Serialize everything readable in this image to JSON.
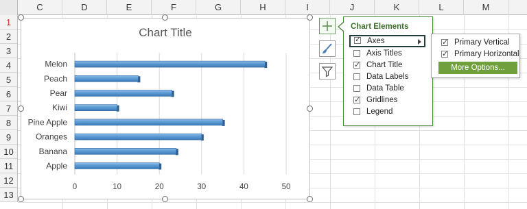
{
  "sheet": {
    "columns": [
      "C",
      "D",
      "E",
      "F",
      "G",
      "H",
      "I",
      "J",
      "K",
      "L",
      "M"
    ],
    "rows": [
      "1",
      "2",
      "3",
      "4",
      "5",
      "6",
      "7",
      "8",
      "9",
      "10",
      "11",
      "12",
      "13"
    ]
  },
  "chart": {
    "title": "Chart Title"
  },
  "chart_data": {
    "type": "bar",
    "orientation": "horizontal",
    "title": "Chart Title",
    "categories": [
      "Melon",
      "Peach",
      "Pear",
      "Kiwi",
      "Pine Apple",
      "Oranges",
      "Banana",
      "Apple"
    ],
    "values": [
      45,
      15,
      23,
      10,
      35,
      30,
      24,
      20
    ],
    "xlim": [
      0,
      50
    ],
    "ticks": [
      "0",
      "10",
      "20",
      "30",
      "40",
      "50"
    ],
    "grid": true,
    "bar_color": "#5b9bd5"
  },
  "side_buttons": {
    "chart_elements": "plus-icon",
    "chart_styles": "brush-icon",
    "chart_filters": "filter-icon"
  },
  "flyout": {
    "title": "Chart Elements",
    "options": [
      {
        "label": "Axes",
        "checked": true
      },
      {
        "label": "Axis Titles",
        "checked": false
      },
      {
        "label": "Chart Title",
        "checked": true
      },
      {
        "label": "Data Labels",
        "checked": false
      },
      {
        "label": "Data Table",
        "checked": false
      },
      {
        "label": "Gridlines",
        "checked": true
      },
      {
        "label": "Legend",
        "checked": false
      }
    ]
  },
  "axes_submenu": {
    "primary_vertical": "Primary Vertical",
    "primary_horizontal": "Primary Horizontal",
    "more_options": "More Options..."
  },
  "colors": {
    "accent_green": "#70a03c",
    "flyout_border": "#4a8a3c",
    "title_green": "#3d6e2e"
  }
}
